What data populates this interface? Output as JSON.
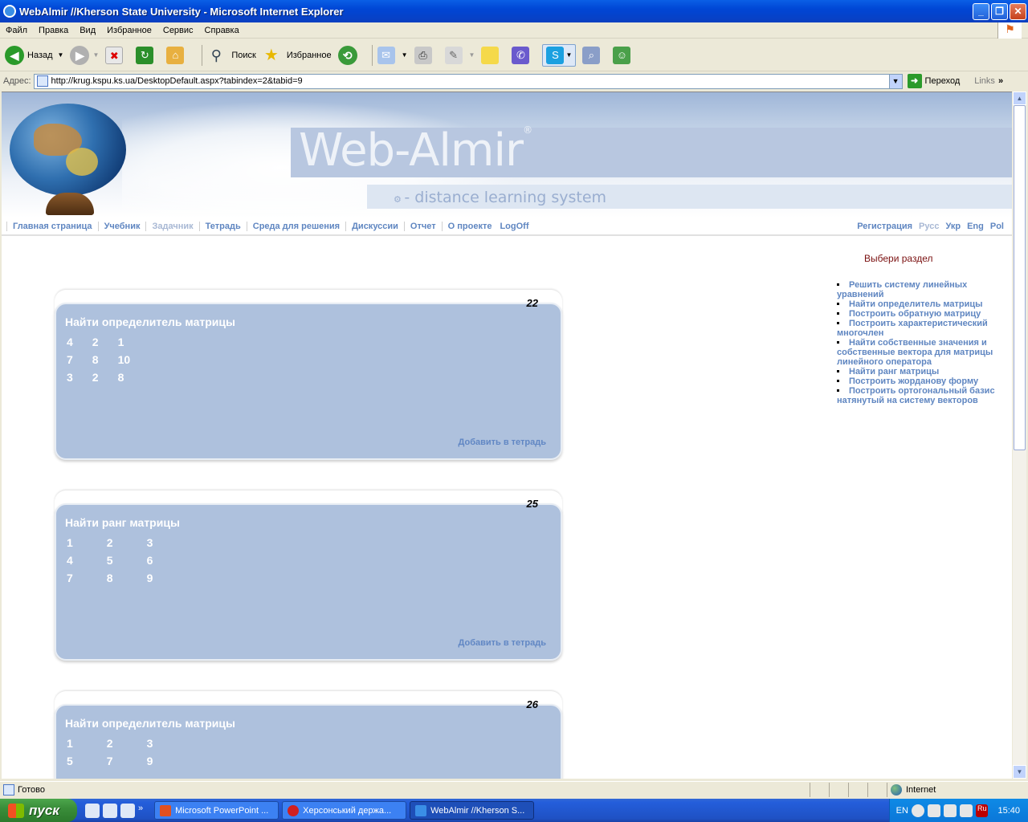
{
  "window": {
    "title": "WebAlmir //Kherson State University - Microsoft Internet Explorer"
  },
  "menu": [
    "Файл",
    "Правка",
    "Вид",
    "Избранное",
    "Сервис",
    "Справка"
  ],
  "toolbar": {
    "back": "Назад",
    "search": "Поиск",
    "favorites": "Избранное"
  },
  "address": {
    "label": "Адрес:",
    "url": "http://krug.kspu.ks.ua/DesktopDefault.aspx?tabindex=2&tabid=9",
    "go": "Переход",
    "links": "Links"
  },
  "banner": {
    "brand": "Web-Almir",
    "tagline": "- distance learning system"
  },
  "nav": {
    "left": [
      "Главная страница",
      "Учебник",
      "Задачник",
      "Тетрадь",
      "Среда для решения",
      "Дискуссии",
      "Отчет",
      "О проекте",
      "LogOff"
    ],
    "right": [
      "Регистрация",
      "Русс",
      "Укр",
      "Eng",
      "Pol"
    ],
    "current": "Задачник"
  },
  "tasks": [
    {
      "num": "22",
      "title": "Найти определитель матрицы",
      "rows": [
        [
          "4",
          "2",
          "1"
        ],
        [
          "7",
          "8",
          "10"
        ],
        [
          "3",
          "2",
          "8"
        ]
      ],
      "add": "Добавить в тетрадь"
    },
    {
      "num": "25",
      "title": "Найти ранг матрицы",
      "rows": [
        [
          "1",
          "2",
          "3"
        ],
        [
          "4",
          "5",
          "6"
        ],
        [
          "7",
          "8",
          "9"
        ]
      ],
      "add": "Добавить в тетрадь"
    },
    {
      "num": "26",
      "title": "Найти определитель матрицы",
      "rows": [
        [
          "1",
          "2",
          "3"
        ],
        [
          "5",
          "7",
          "9"
        ]
      ],
      "add": ""
    }
  ],
  "side": {
    "title": "Выбери раздел",
    "items": [
      "Решить систему линейных уравнений",
      "Найти определитель матрицы",
      "Построить обратную матрицу",
      "Построить характеристический многочлен",
      "Найти собственные значения и собственные вектора для матрицы линейного оператора",
      "Найти ранг матрицы",
      "Построить жорданову форму",
      "Построить ортогональный базис натянутый на систему векторов"
    ]
  },
  "status": {
    "text": "Готово",
    "zone": "Internet"
  },
  "taskbar": {
    "start": "пуск",
    "tasks": [
      "Microsoft PowerPoint ...",
      "Херсонський держа...",
      "WebAlmir //Kherson S..."
    ],
    "lang": "EN",
    "clock": "15:40"
  }
}
